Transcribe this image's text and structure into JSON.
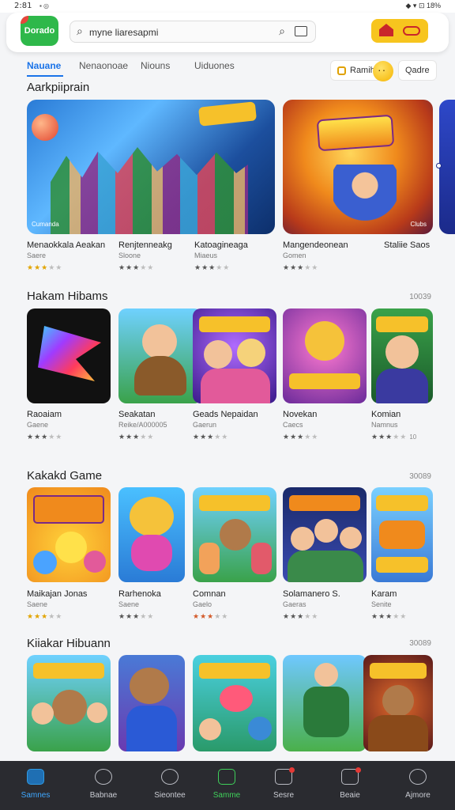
{
  "status_bar": {
    "time": "2:81",
    "left_icons": "▪ ◎",
    "right_icons": "◆ ▾ ⊡ 18%"
  },
  "header": {
    "logo_text": "Dorado",
    "search_placeholder": "myne liaresapmi"
  },
  "tabs": [
    {
      "label": "Nauane",
      "active": true
    },
    {
      "label": "Nenaonoae",
      "active": false
    },
    {
      "label": "Niouns",
      "active": false
    },
    {
      "label": "Uiduones",
      "active": false
    }
  ],
  "chips": [
    {
      "label": "Ramih"
    },
    {
      "label": "Qadre"
    }
  ],
  "featured": {
    "title": "Aarkpiiprain",
    "cards": [
      {
        "badge": "Cumanda"
      },
      {
        "badge": "Clubs"
      }
    ],
    "apps": [
      {
        "name": "Menaokkala Aeakan",
        "sub": "Saere",
        "stars": 3,
        "color": "gold"
      },
      {
        "name": "Renjtenneakg",
        "sub": "Sloone",
        "stars": 3,
        "color": "gray"
      },
      {
        "name": "Katoagineaga",
        "sub": "Miaeus",
        "stars": 3,
        "color": "gray"
      },
      {
        "name": "Mangendeonean",
        "sub": "Gomen",
        "stars": 3,
        "color": "gray"
      },
      {
        "name": "Staliie Saos",
        "sub": "",
        "stars": 0,
        "color": "gray"
      }
    ]
  },
  "section2": {
    "title": "Hakam Hibams",
    "more": "10039",
    "apps": [
      {
        "name": "Raoaiam",
        "sub": "Gaene",
        "stars": 3,
        "color": "gray",
        "num": ""
      },
      {
        "name": "Seakatan",
        "sub": "Reike/A000005",
        "stars": 3,
        "color": "gray",
        "num": ""
      },
      {
        "name": "Geads Nepaidan",
        "sub": "Gaerun",
        "stars": 3,
        "color": "gray",
        "num": ""
      },
      {
        "name": "Novekan",
        "sub": "Caecs",
        "stars": 3,
        "color": "gray",
        "num": ""
      },
      {
        "name": "Komian",
        "sub": "Namnus",
        "stars": 3,
        "color": "gray",
        "num": "10"
      }
    ]
  },
  "section3": {
    "title": "Kakakd Game",
    "more": "30089",
    "apps": [
      {
        "name": "Maikajan Jonas",
        "sub": "Saene",
        "stars": 3,
        "color": "gold"
      },
      {
        "name": "Rarhenoka",
        "sub": "Saene",
        "stars": 3,
        "color": "gray"
      },
      {
        "name": "Comnan",
        "sub": "Gaelo",
        "stars": 3,
        "color": "red"
      },
      {
        "name": "Solamanero S.",
        "sub": "Gaeras",
        "stars": 3,
        "color": "gray"
      },
      {
        "name": "Karam",
        "sub": "Senite",
        "stars": 3,
        "color": "gray"
      }
    ]
  },
  "section4": {
    "title": "Kiiakar Hibuann",
    "more": "30089"
  },
  "bottom_nav": [
    {
      "label": "Samnes",
      "icon": "home-icon",
      "state": "active"
    },
    {
      "label": "Babnae",
      "icon": "chat-icon",
      "state": "normal"
    },
    {
      "label": "Sieontee",
      "icon": "search-icon",
      "state": "normal"
    },
    {
      "label": "Samme",
      "icon": "games-icon",
      "state": "green"
    },
    {
      "label": "Sesre",
      "icon": "apps-icon",
      "state": "notif"
    },
    {
      "label": "Beaie",
      "icon": "people-icon",
      "state": "notif"
    },
    {
      "label": "Ajmore",
      "icon": "search-icon",
      "state": "normal"
    }
  ],
  "colors": {
    "accent": "#1a73e8",
    "nav_bg": "#2a2b30",
    "star": "#e2a400"
  }
}
